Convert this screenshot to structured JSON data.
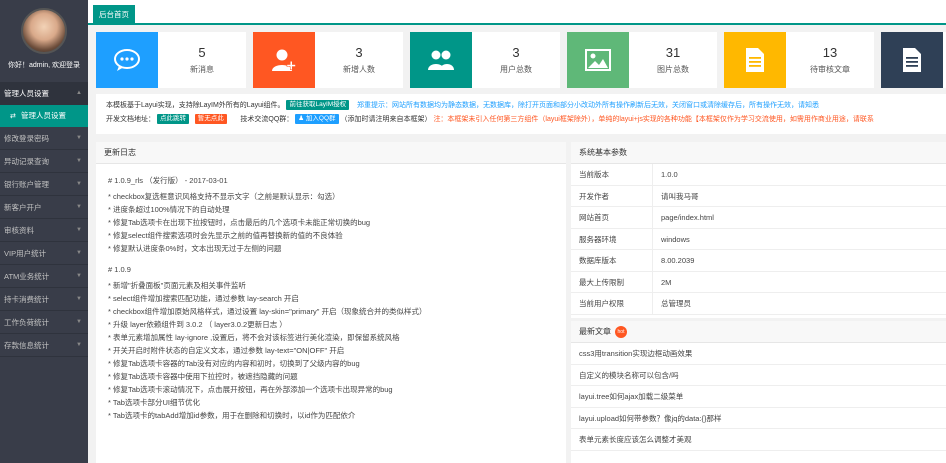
{
  "sidebar": {
    "greeting": "你好！admin, 欢迎登录",
    "items": [
      {
        "label": "管理人员设置",
        "open": true
      },
      {
        "label": "修改登录密码"
      },
      {
        "label": "异动记录查询"
      },
      {
        "label": "银行账户管理"
      },
      {
        "label": "新客户开户"
      },
      {
        "label": "审核资料"
      },
      {
        "label": "VIP用户统计"
      },
      {
        "label": "ATM业务统计"
      },
      {
        "label": "持卡消费统计"
      },
      {
        "label": "工作负荷统计"
      },
      {
        "label": "存款信息统计"
      }
    ],
    "sub_item": "管理人员设置"
  },
  "topbar": {
    "home_tab": "后台首页"
  },
  "stats": [
    {
      "value": "5",
      "label": "新消息",
      "color": "#1e9fff",
      "icon": "chat-icon"
    },
    {
      "value": "3",
      "label": "新增人数",
      "color": "#ff5722",
      "icon": "add-user-icon"
    },
    {
      "value": "3",
      "label": "用户总数",
      "color": "#009688",
      "icon": "users-icon"
    },
    {
      "value": "31",
      "label": "图片总数",
      "color": "#5fb878",
      "icon": "image-icon"
    },
    {
      "value": "13",
      "label": "待审核文章",
      "color": "#ffb800",
      "icon": "document-icon"
    }
  ],
  "notice": {
    "line1_text": "本模板基于Layui实现，支持除LayIM外所有的Layui组件。",
    "line1_button": "前往获取LayIM授权",
    "line1_tip": "郑重提示：网站所有数据均为静态数据，无数据库，除打开页面和部分小改动外所有操作刷新后无效，关闭窗口或清除缓存后，所有操作无效，请知悉",
    "line2_label": "开发文档地址：",
    "line2_btn1": "点此跳转",
    "line2_btn2": "暂无点此",
    "line2_qq_label": "技术交流QQ群：",
    "line2_qq_btn": "加入QQ群",
    "line2_note": "（添加时请注明来自本框架）",
    "line2_warn": "注：本框架未引入任何第三方组件（layui框架除外），单纯的layui+js实现的各种功能【本框架仅作为学习交流使用，如需用作商业用途，请联系"
  },
  "log": {
    "title": "更新日志",
    "sections": [
      {
        "heading": "# 1.0.9_rls （发行版） - 2017-03-01",
        "lines": [
          "* checkbox复选框意识风格支持不显示文字（之前是默认显示：勾选）",
          "* 进度条超过100%情况下的自动处理",
          "* 修复Tab选项卡在出现下拉按钮时，点击最后的几个选项卡未能正常切换的bug",
          "* 修复select组件搜索选项时会先显示之前的值再替换新的值的不良体验",
          "* 修复默认进度条0%时，文本出现无过于左侧的问题"
        ]
      },
      {
        "heading": "# 1.0.9",
        "lines": [
          "* 新增\"折叠面板\"页面元素及相关事件监听",
          "* select组件增加搜索匹配功能，通过参数 lay-search 开启",
          "* checkbox组件增加原始风格样式，通过设置 lay-skin=\"primary\" 开启（现象统合并的类似样式）",
          "* 升级 layer依赖组件到 3.0.2 （ layer3.0.2更新日志 ）",
          "* 表单元素增加属性 lay-ignore ,设置后，将不会对该标签进行美化渲染，即保留系统风格",
          "* 开关开启时附件状态的自定义文本，通过参数 lay-text=\"ON|OFF\" 开启",
          "* 修复Tab选项卡容器的Tab没有对应的内容和初时，切换到了父级内容的bug",
          "* 修复Tab选项卡容器中使用下拉控时，被遮挡隐藏的问题",
          "* 修复Tab选项卡滚动情况下，点击展开按钮，再在外部添加一个选项卡出现异常的bug",
          "* Tab选项卡部分UI细节优化",
          "* Tab选项卡的tabAdd增加id参数，用于在删除和切换时，以id作为匹配依介"
        ]
      }
    ]
  },
  "sys": {
    "title": "系统基本参数",
    "rows": [
      {
        "k": "当前版本",
        "v": "1.0.0"
      },
      {
        "k": "开发作者",
        "v": "请叫我马哥"
      },
      {
        "k": "网站首页",
        "v": "page/index.html"
      },
      {
        "k": "服务器环境",
        "v": "windows"
      },
      {
        "k": "数据库版本",
        "v": "8.00.2039"
      },
      {
        "k": "最大上传限制",
        "v": "2M"
      },
      {
        "k": "当前用户权限",
        "v": "总管理员"
      }
    ]
  },
  "news": {
    "title": "最新文章",
    "badge": "hot",
    "items": [
      "css3用transition实现边框动画效果",
      "自定义的模块名称可以包含/吗",
      "layui.tree如何ajax加载二级菜单",
      "layui.upload如何带参数？像jq的data:{}那样",
      "表单元素长度应该怎么调整才美观"
    ]
  }
}
